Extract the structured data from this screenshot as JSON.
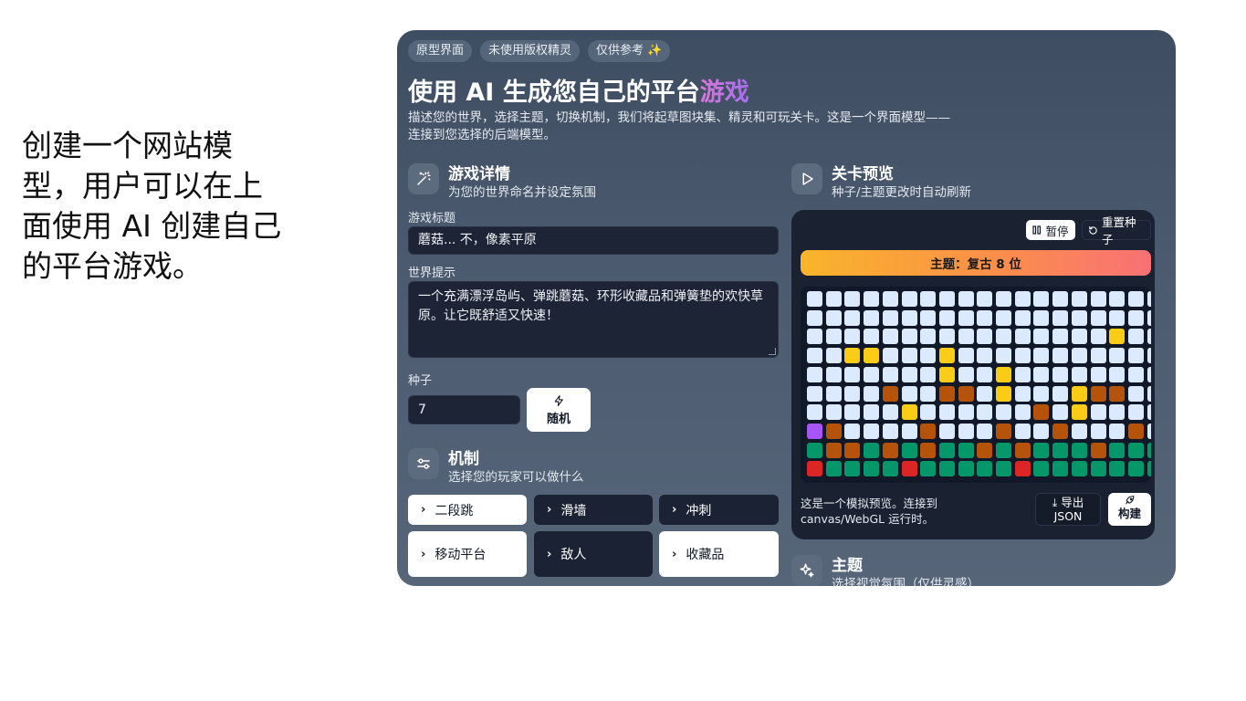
{
  "caption": "创建一个网站模型，用户可以在上面使用 AI 创建自己的平台游戏。",
  "pills": [
    "原型界面",
    "未使用版权精灵",
    "仅供参考 ✨"
  ],
  "headline": {
    "main": "使用 AI 生成您自己的平台",
    "accent": "游戏"
  },
  "subtitle": "描述您的世界，选择主题，切换机制，我们将起草图块集、精灵和可玩关卡。这是一个界面模型——连接到您选择的后端模型。",
  "details": {
    "icon": "magic-wand-icon",
    "title": "游戏详情",
    "subtitle": "为您的世界命名并设定氛围",
    "title_label": "游戏标题",
    "title_value": "蘑菇... 不，像素平原",
    "prompt_label": "世界提示",
    "prompt_value": "一个充满漂浮岛屿、弹跳蘑菇、环形收藏品和弹簧垫的欢快草原。让它既舒适又快速！",
    "seed_label": "种子",
    "seed_value": "7",
    "random_label": "随机",
    "random_icon": "lightning-icon"
  },
  "mechanics": {
    "icon": "sliders-icon",
    "title": "机制",
    "subtitle": "选择您的玩家可以做什么",
    "items": [
      {
        "label": "二段跳",
        "active": true
      },
      {
        "label": "滑墙",
        "active": false
      },
      {
        "label": "冲刺",
        "active": false
      },
      {
        "label": "移动平台",
        "active": true
      },
      {
        "label": "敌人",
        "active": false
      },
      {
        "label": "收藏品",
        "active": true
      }
    ]
  },
  "preview": {
    "icon": "play-icon",
    "title": "关卡预览",
    "subtitle": "种子/主题更改时自动刷新",
    "pause_label": "暂停",
    "pause_icon": "pause-icon",
    "reseed_label": "重置种子",
    "reseed_icon": "reset-icon",
    "theme_label": "主题：复古 8 位",
    "note": "这是一个模拟预览。连接到 canvas/WebGL 运行时。",
    "export_label": "导出",
    "export_sub": "JSON",
    "export_icon": "download-icon",
    "build_label": "构建",
    "build_icon": "rocket-icon",
    "tile_rows": [
      "SSSSSSSSSSSSSSSSSSS",
      "SSSSSSSSSSSSSSSSSSS",
      "SSSSSSSSSSSSSSSSYSS",
      "SSYYSSSYSSSSSSSSSSS",
      "SSSSSSSYSSYSSSSSSSS",
      "SSSSBSSBBSYSSSYBBSS",
      "SSSSSYSSSSSSBSYSSSS",
      "PBSSSSBSSSBSSBSSSBS",
      "GBBGBGBGGBGBGGGBGGG",
      "RGGGGRGGGGGRGGGGGGG"
    ],
    "tile_colors": {
      "S": "#dbeafe",
      "Y": "#facc15",
      "B": "#b45309",
      "P": "#a855f7",
      "G": "#059669",
      "R": "#dc2626"
    }
  },
  "theme_section": {
    "icon": "sparkles-icon",
    "title": "主题",
    "subtitle": "选择视觉氛围（仅供灵感）"
  }
}
